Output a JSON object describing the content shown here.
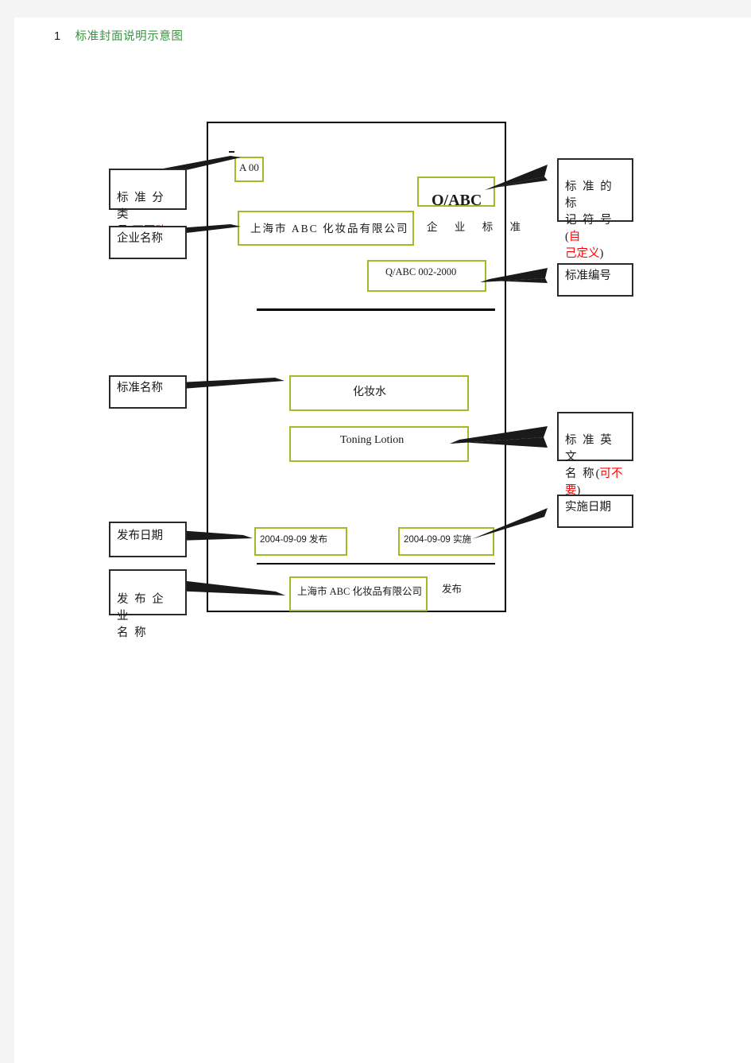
{
  "heading": {
    "number": "1",
    "title": "标准封面说明示意图",
    "title_color": "#3d9142"
  },
  "colors": {
    "green_box_border": "#9cbd26",
    "callout_border": "#2a2a2a",
    "red_emphasis": "#ff0000",
    "frame_border": "#000000",
    "page_background": "#f4f4f4",
    "sheet_background": "#ffffff"
  },
  "cover": {
    "class_number": "A 00",
    "company_name": "上海市 ABC 化妆品有限公司",
    "standard_type": "企 业 标 准",
    "standard_mark": "Q/ABC",
    "standard_code": "Q/ABC 002-2000",
    "standard_name_cn": "化妆水",
    "standard_name_en": "Toning Lotion",
    "issue_date": "2004-09-09 发布",
    "effective_date": "2004-09-09 实施",
    "issuer_company": "上海市 ABC 化妆品有限公司",
    "issuer_suffix": "发布"
  },
  "callouts": {
    "class_number": {
      "text": "标 准 分 类\n号(",
      "red": "不要改",
      "tail": ")"
    },
    "company_name": {
      "text": "企业名称"
    },
    "standard_mark": {
      "text": "标 准 的 标\n记 符 号 (",
      "red": "自\n己定义",
      "tail": ")"
    },
    "standard_code": {
      "text": "标准编号"
    },
    "standard_name": {
      "text": "标准名称"
    },
    "standard_name_en": {
      "text": "标 准 英 文\n名 称 (",
      "red": "可不\n要",
      "tail": ")"
    },
    "issue_date": {
      "text": "发布日期"
    },
    "effective_date": {
      "text": "实施日期"
    },
    "issuer_company": {
      "text": "发 布 企 业\n名 称"
    }
  }
}
